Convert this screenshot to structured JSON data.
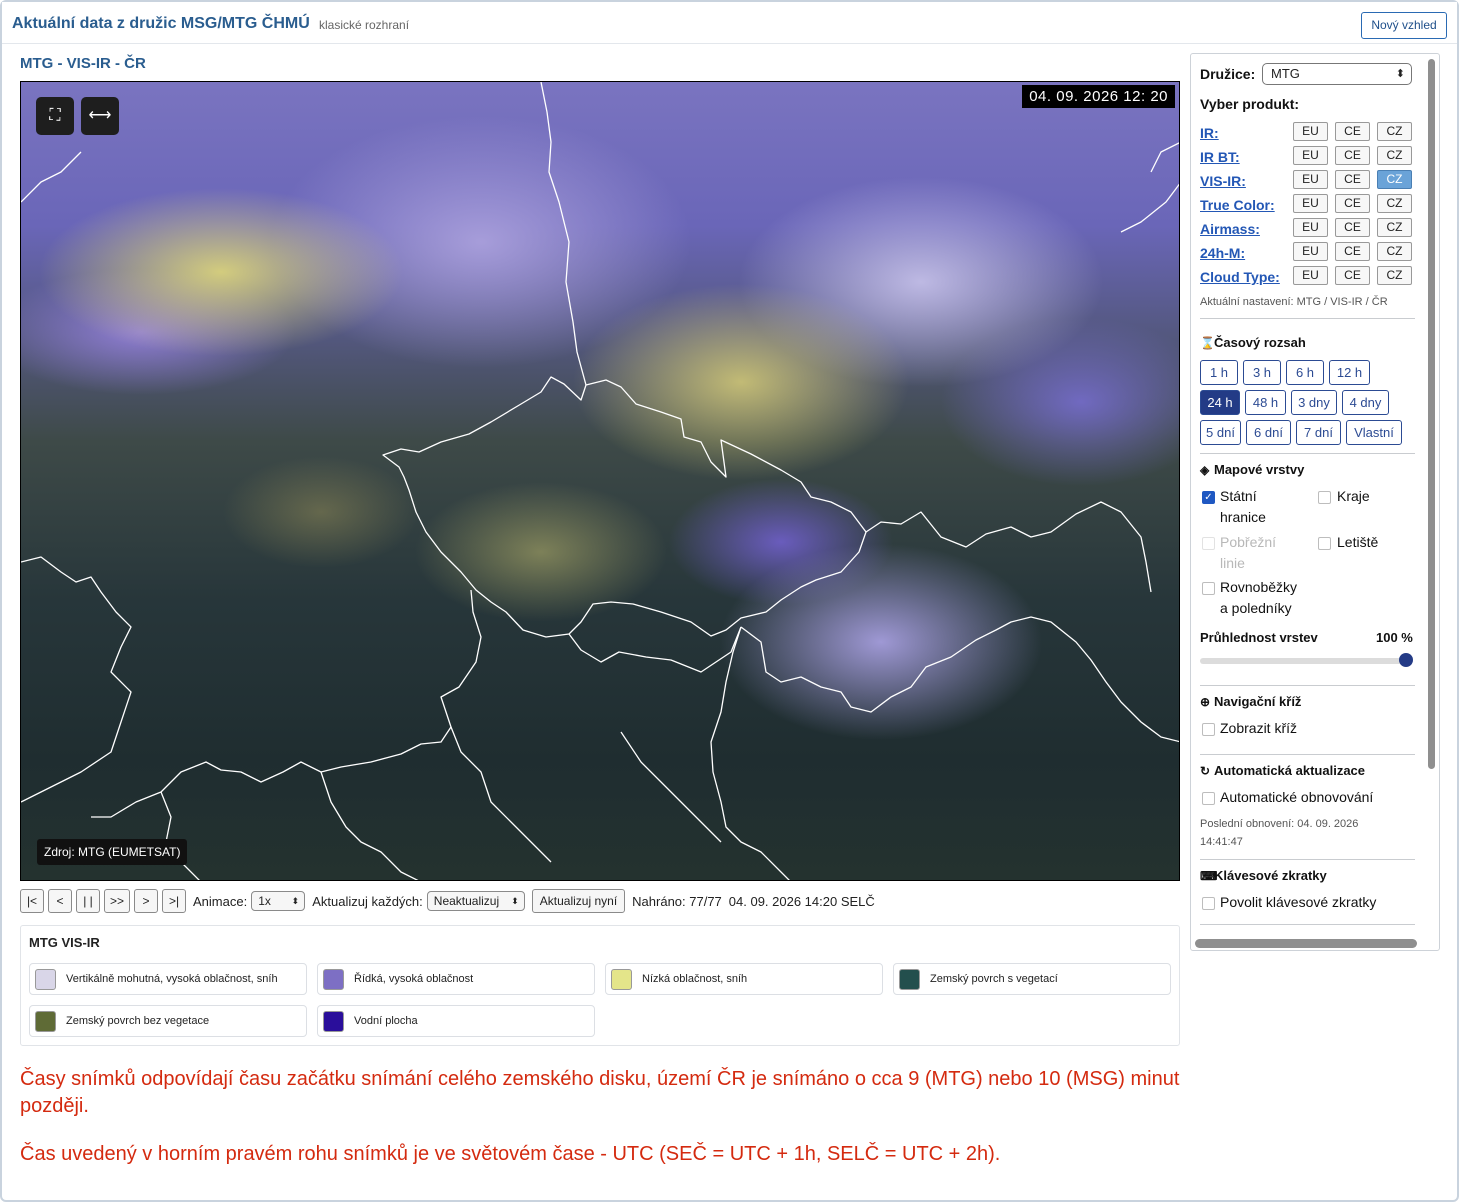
{
  "header": {
    "title": "Aktuální data z družic MSG/MTG ČHMÚ",
    "subtitle": "klasické rozhraní",
    "new_look_button": "Nový vzhled"
  },
  "map": {
    "title": "MTG - VIS-IR - ČR",
    "timestamp": "04. 09. 2026 12: 20",
    "source": "Zdroj: MTG (EUMETSAT)",
    "fullscreen_icon": "fullscreen-icon",
    "wide_icon": "expand-horizontal-icon"
  },
  "controls": {
    "first": "|<",
    "prev": "<",
    "pause": "| |",
    "play": ">>",
    "next": ">",
    "last": ">|",
    "animation_label": "Animace:",
    "animation_value": "1x",
    "update_label": "Aktualizuj každých:",
    "update_value": "Neaktualizuj",
    "update_now": "Aktualizuj nyní",
    "loaded": "Nahráno: 77/77",
    "datetime": "04. 09. 2026 14:20 SELČ"
  },
  "legend": {
    "title": "MTG VIS-IR",
    "items": [
      {
        "label": "Vertikálně mohutná, vysoká oblačnost, sníh",
        "color": "#d9d6e8"
      },
      {
        "label": "Řídká, vysoká oblačnost",
        "color": "#7d6fc4"
      },
      {
        "label": "Nízká oblačnost, sníh",
        "color": "#e4e58a"
      },
      {
        "label": "Zemský povrch s vegetací",
        "color": "#234f4d"
      },
      {
        "label": "Zemský povrch bez vegetace",
        "color": "#5f6b36"
      },
      {
        "label": "Vodní plocha",
        "color": "#2a0e9b"
      }
    ]
  },
  "notes": {
    "line1": "Časy snímků odpovídají času začátku snímání celého zemského disku, území ČR je snímáno o cca 9 (MTG) nebo 10 (MSG) minut později.",
    "line2": "Čas uvedený v horním pravém rohu snímků je ve světovém čase - UTC (SEČ = UTC + 1h, SELČ = UTC + 2h)."
  },
  "panel": {
    "satellite_label": "Družice:",
    "satellite_value": "MTG",
    "product_heading": "Vyber produkt:",
    "products": [
      {
        "name": "IR:",
        "eu": "EU",
        "ce": "CE",
        "cz": "CZ"
      },
      {
        "name": "IR BT:",
        "eu": "EU",
        "ce": "CE",
        "cz": "CZ"
      },
      {
        "name": "VIS-IR:",
        "eu": "EU",
        "ce": "CE",
        "cz": "CZ"
      },
      {
        "name": "True Color:",
        "eu": "EU",
        "ce": "CE",
        "cz": "CZ"
      },
      {
        "name": "Airmass:",
        "eu": "EU",
        "ce": "CE",
        "cz": "CZ"
      },
      {
        "name": "24h-M:",
        "eu": "EU",
        "ce": "CE",
        "cz": "CZ"
      },
      {
        "name": "Cloud Type:",
        "eu": "EU",
        "ce": "CE",
        "cz": "CZ"
      }
    ],
    "current_setting": "Aktuální nastavení: MTG / VIS-IR / ČR",
    "time_range": {
      "heading": "Časový rozsah",
      "icon": "hourglass-icon",
      "buttons": [
        "1 h",
        "3 h",
        "6 h",
        "12 h",
        "24 h",
        "48 h",
        "3 dny",
        "4 dny",
        "5 dní",
        "6 dní",
        "7 dní",
        "Vlastní"
      ],
      "active": "24 h"
    },
    "layers": {
      "heading": "Mapové vrstvy",
      "icon": "layers-icon",
      "state_borders": "Státní hranice",
      "state_borders_line1": "Státní",
      "state_borders_line2": "hranice",
      "regions": "Kraje",
      "coast_line1": "Pobřežní",
      "coast_line2": "linie",
      "airports": "Letiště",
      "grid_line1": "Rovnoběžky",
      "grid_line2": "a poledníky",
      "opacity_label": "Průhlednost vrstev",
      "opacity_value": "100 %",
      "opacity": 1.0
    },
    "crosshair": {
      "heading": "Navigační kříž",
      "icon": "crosshair-icon",
      "show": "Zobrazit kříž"
    },
    "autoupdate": {
      "heading": "Automatická aktualizace",
      "icon": "refresh-icon",
      "option": "Automatické obnovování",
      "last_line1": "Poslední obnovení: 04. 09. 2026",
      "last_line2": "14:41:47"
    },
    "shortcuts": {
      "heading": "Klávesové zkratky",
      "icon": "keyboard-icon",
      "option": "Povolit klávesové zkratky"
    }
  }
}
